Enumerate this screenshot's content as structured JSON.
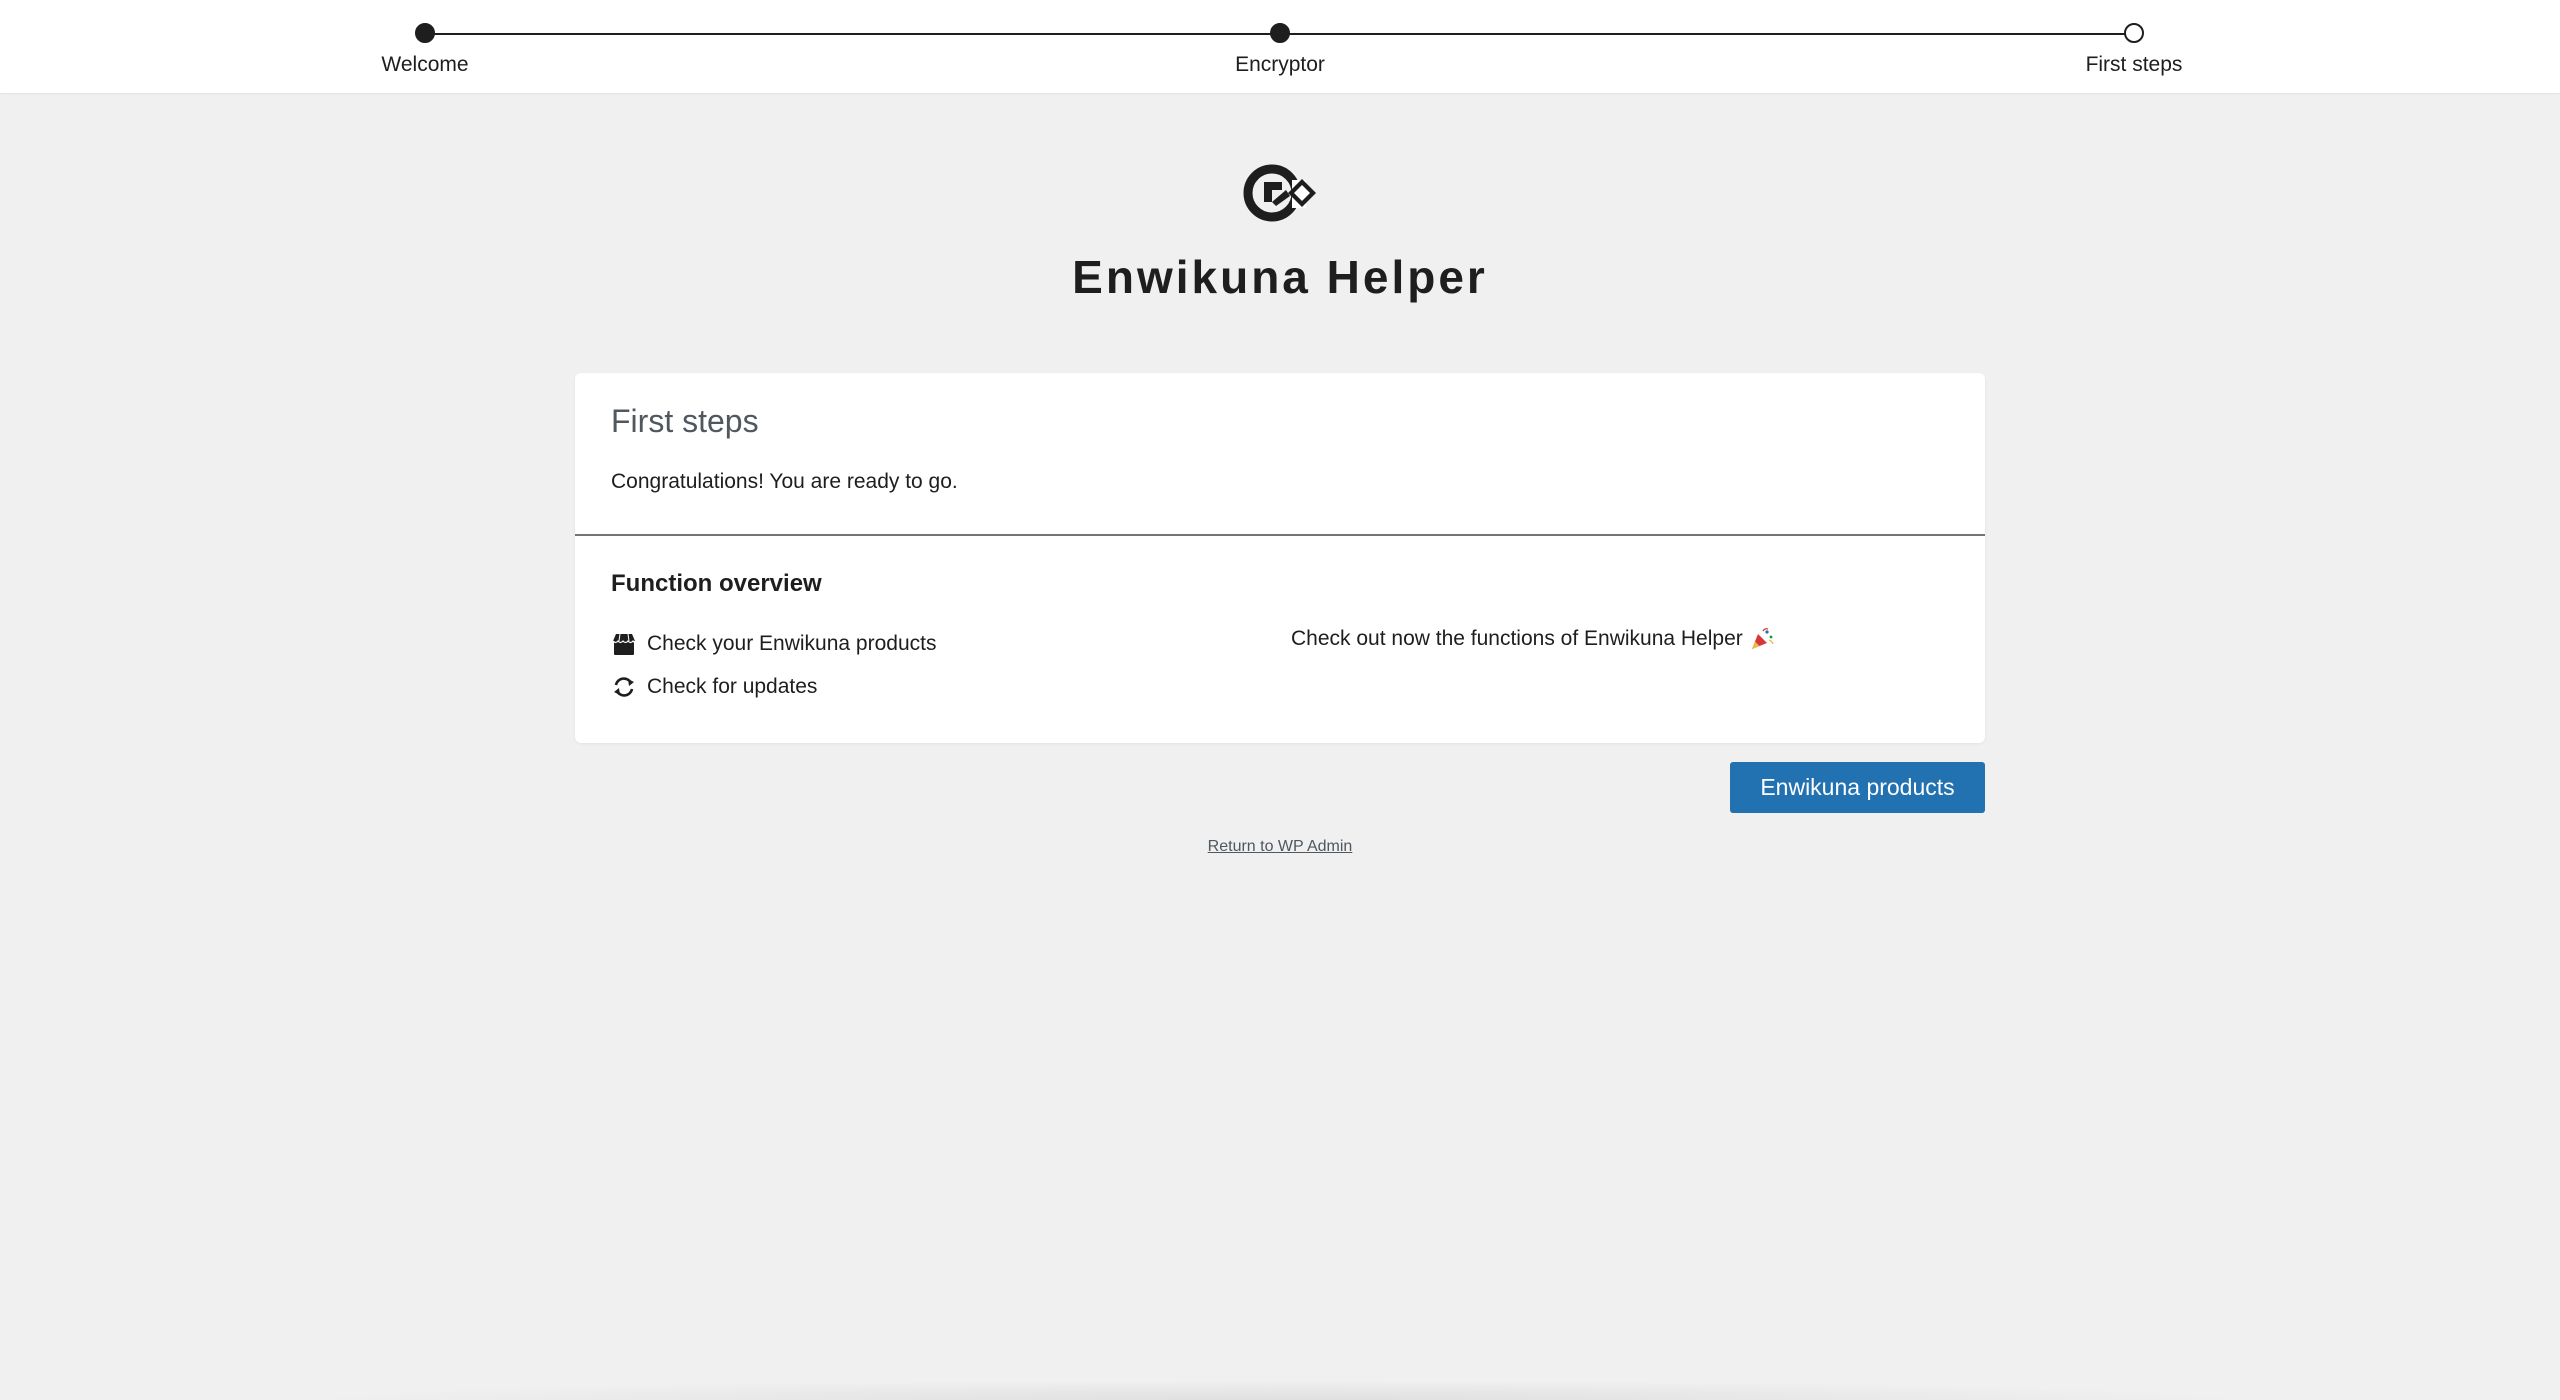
{
  "stepper": {
    "steps": [
      {
        "label": "Welcome",
        "state": "done"
      },
      {
        "label": "Encryptor",
        "state": "done"
      },
      {
        "label": "First steps",
        "state": "current"
      }
    ]
  },
  "app": {
    "logo_icon": "enwikuna-logo-icon",
    "title": "Enwikuna Helper"
  },
  "card": {
    "title": "First steps",
    "description": "Congratulations! You are ready to go.",
    "section_title": "Function overview",
    "functions": [
      {
        "icon": "shop-icon",
        "label": "Check your Enwikuna products"
      },
      {
        "icon": "refresh-icon",
        "label": "Check for updates"
      }
    ],
    "right_text": "Check out now the functions of Enwikuna Helper",
    "right_icon": "party-popper-icon"
  },
  "actions": {
    "primary_label": "Enwikuna products",
    "primary_color": "#2271b1",
    "return_label": "Return to WP Admin"
  }
}
